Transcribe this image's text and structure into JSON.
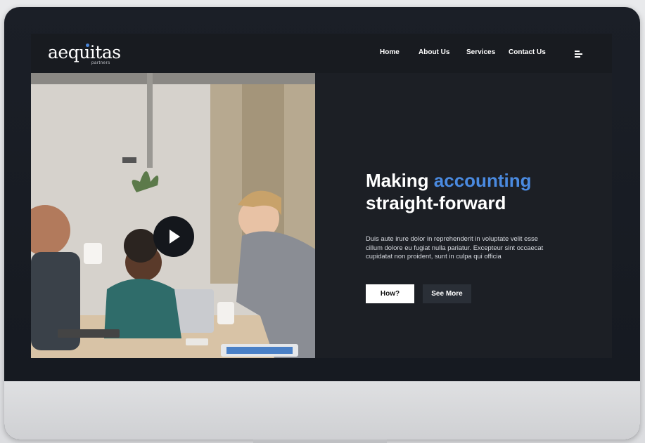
{
  "logo": {
    "wordmark": "aequitas",
    "tagline": "partners"
  },
  "nav": {
    "items": [
      "Home",
      "About Us",
      "Services",
      "Contact Us"
    ],
    "menu_icon": "hamburger-icon"
  },
  "hero": {
    "title_part1": "Making ",
    "title_accent": "accounting",
    "title_part2": "straight-forward",
    "description": "Duis aute irure dolor in reprehenderit in voluptate velit esse cillum dolore eu fugiat nulla pariatur. Excepteur sint occaecat cupidatat non proident, sunt in culpa qui officia",
    "primary_button": "How?",
    "secondary_button": "See More",
    "play_icon": "play-icon"
  },
  "colors": {
    "accent": "#4a8ae0",
    "background": "#1c1f25",
    "nav": "#181b20"
  }
}
